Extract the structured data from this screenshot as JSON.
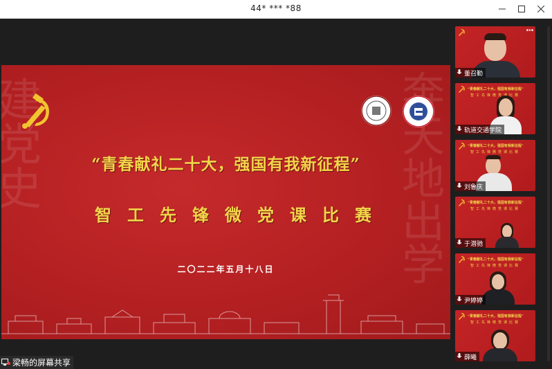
{
  "window": {
    "title": "44* *** *88"
  },
  "slide": {
    "title_line1": "“青春献礼二十大，强国有我新征程”",
    "title_line2": "智工先锋微党课比赛",
    "date": "二〇二二年五月十八日",
    "bg_left_chars": "建党史",
    "bg_right_chars": "奔天地出学"
  },
  "share": {
    "label": "梁畅的屏幕共享"
  },
  "participants": [
    {
      "name": "董召勤"
    },
    {
      "name": "轨道交通学院"
    },
    {
      "name": "刘鲁庆"
    },
    {
      "name": "于潜驰"
    },
    {
      "name": "尹婷婷"
    },
    {
      "name": "薛曦"
    }
  ],
  "tile_text": {
    "line1": "“青春献礼二十大，强国有我新征程”",
    "line2": "智工先锋微党课比赛"
  },
  "colors": {
    "slide_red": "#b42022",
    "title_gold": "#f3d54a",
    "bg_dark": "#1e1e1e"
  }
}
